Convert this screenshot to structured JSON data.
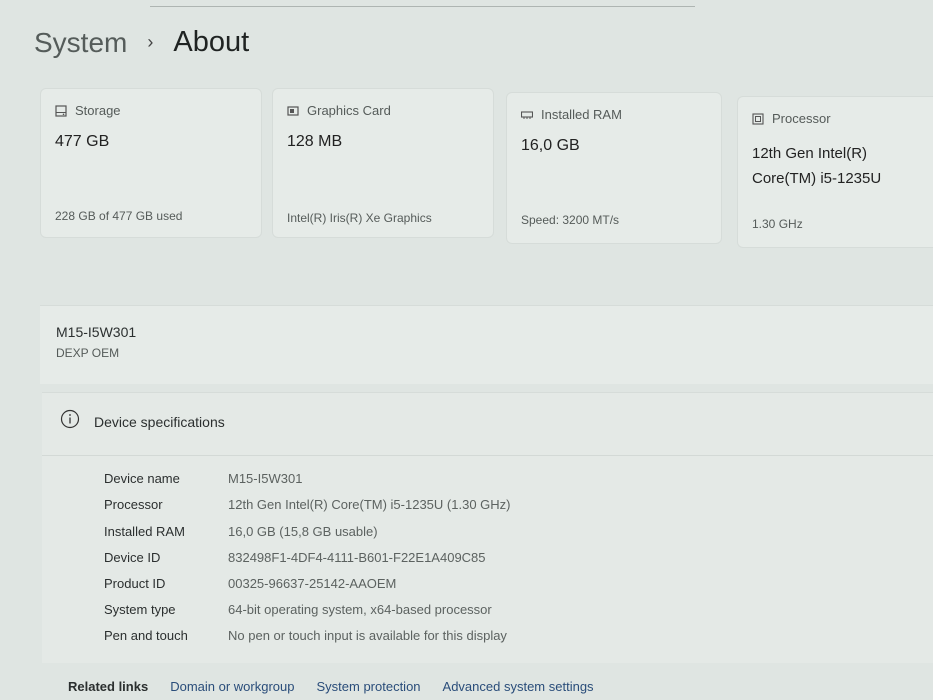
{
  "breadcrumb": {
    "parent": "System",
    "separator": "›",
    "current": "About"
  },
  "cards": [
    {
      "label": "Storage",
      "value": "477 GB",
      "sub": "228 GB of 477 GB used",
      "icon": "storage-icon"
    },
    {
      "label": "Graphics Card",
      "value": "128 MB",
      "sub": "Intel(R) Iris(R) Xe Graphics",
      "icon": "graphics-card-icon"
    },
    {
      "label": "Installed RAM",
      "value": "16,0 GB",
      "sub": "Speed: 3200 MT/s",
      "icon": "ram-icon"
    },
    {
      "label": "Processor",
      "value_line1": "12th Gen Intel(R)",
      "value_line2": "Core(TM) i5-1235U",
      "sub": "1.30 GHz",
      "icon": "processor-icon"
    }
  ],
  "device": {
    "name": "M15-I5W301",
    "oem": "DEXP OEM"
  },
  "specs": {
    "title": "Device specifications",
    "icon": "info-icon",
    "rows": [
      {
        "label": "Device name",
        "value": "M15-I5W301"
      },
      {
        "label": "Processor",
        "value": "12th Gen Intel(R) Core(TM) i5-1235U (1.30 GHz)"
      },
      {
        "label": "Installed RAM",
        "value": "16,0 GB (15,8 GB usable)"
      },
      {
        "label": "Device ID",
        "value": "832498F1-4DF4-4111-B601-F22E1A409C85"
      },
      {
        "label": "Product ID",
        "value": "00325-96637-25142-AAOEM"
      },
      {
        "label": "System type",
        "value": "64-bit operating system, x64-based processor"
      },
      {
        "label": "Pen and touch",
        "value": "No pen or touch input is available for this display"
      }
    ]
  },
  "related": {
    "title": "Related links",
    "links": [
      "Domain or workgroup",
      "System protection",
      "Advanced system settings"
    ]
  }
}
